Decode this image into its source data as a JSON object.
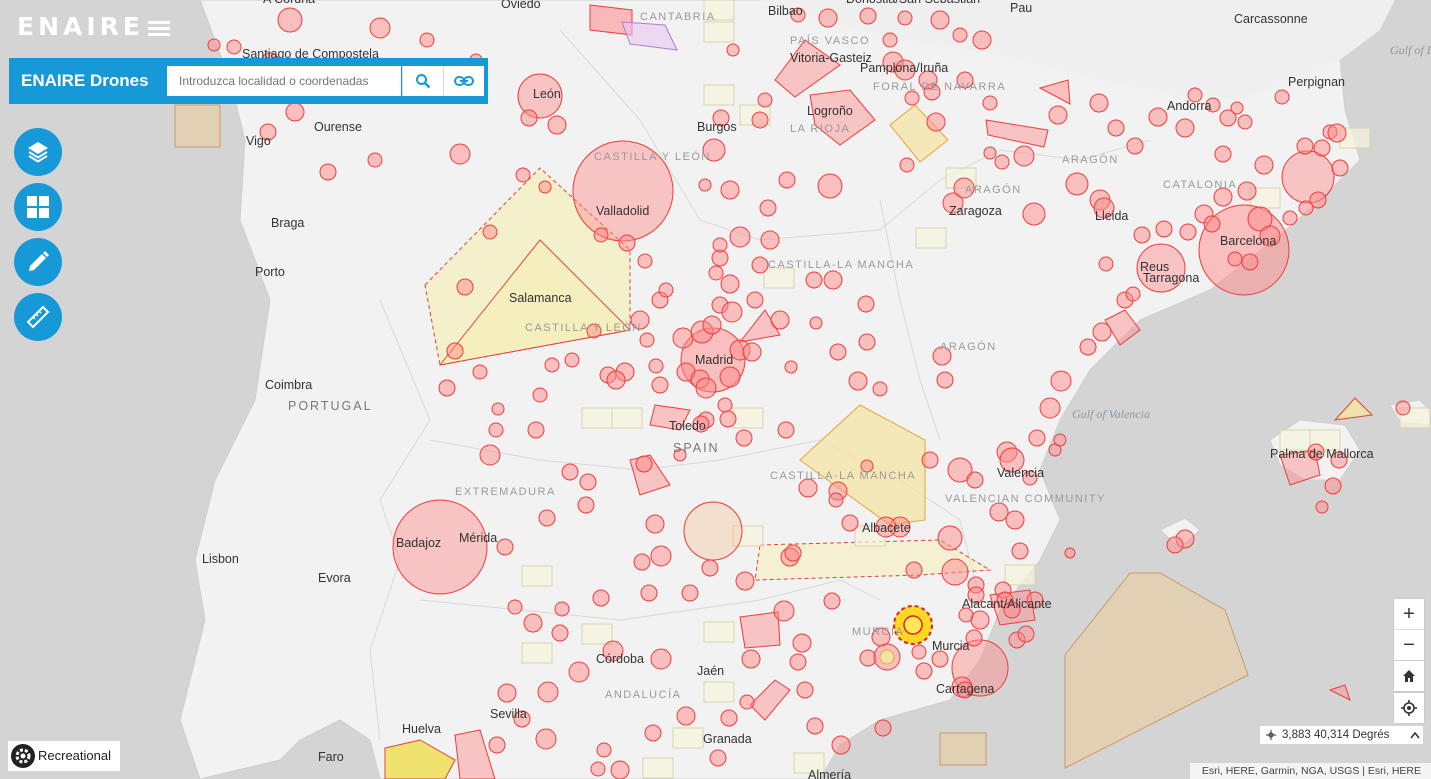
{
  "app": {
    "logo_text": "ENAIRE",
    "brand": "ENAIRE Drones"
  },
  "search": {
    "placeholder": "Introduzca localidad o coordenadas",
    "search_icon": "search-icon",
    "link_icon": "link-icon"
  },
  "tools": [
    {
      "name": "layers-button",
      "icon": "layers-icon"
    },
    {
      "name": "basemap-button",
      "icon": "grid-icon"
    },
    {
      "name": "draw-button",
      "icon": "pencil-icon"
    },
    {
      "name": "measure-button",
      "icon": "ruler-icon"
    }
  ],
  "map_controls": {
    "zoom_in": "+",
    "zoom_out": "−",
    "home_icon": "home-icon",
    "locate_icon": "locate-icon"
  },
  "coordinates": {
    "value": "3,883 40,314 Degrés",
    "crosshair_icon": "crosshair-icon",
    "chevron_icon": "chevron-up-icon"
  },
  "attribution": "Esri, HERE, Garmin, NGA, USGS | Esri, HERE",
  "mode": {
    "label": "Recreational",
    "icon": "gear-icon"
  },
  "colors": {
    "accent": "#1699d6",
    "zone_red_fill": "#ff8a8a",
    "zone_red_stroke": "#f03c3c",
    "zone_yellow_fill": "#f5eeb0",
    "zone_tan_fill": "#e8cfa8",
    "land": "#f2f2f2",
    "sea": "#d2d2d2"
  },
  "places": {
    "cities": [
      "A Coruña",
      "Oviedo",
      "Bilbao",
      "Donostia/San Sebastián",
      "Pau",
      "Carcassonne",
      "Santiago de Compostela",
      "León",
      "Vitoria-Gasteiz",
      "Pamplona/Iruña",
      "Perpignan",
      "Andorra",
      "Ourense",
      "Vigo",
      "Burgos",
      "Logroño",
      "Valladolid",
      "Zaragoza",
      "Lleida",
      "Barcelona",
      "Braga",
      "Porto",
      "Salamanca",
      "Reus",
      "Tarragona",
      "Madrid",
      "Coimbra",
      "Toledo",
      "Valencia",
      "Palma de Mallorca",
      "Badajoz",
      "Mérida",
      "Albacete",
      "Lisbon",
      "Evora",
      "Alacant/Alicante",
      "Murcia",
      "Cartagena",
      "Córdoba",
      "Jaén",
      "Sevilla",
      "Huelva",
      "Granada",
      "Faro",
      "Almería"
    ],
    "regions": [
      "CANTABRIA",
      "PAÍS VASCO",
      "FORAL DE NAVARRA",
      "LA RIOJA",
      "CASTILLA Y LEÓN",
      "ARAGÓN",
      "CATALONIA",
      "CASTILLA-LA MANCHA",
      "CASTILLA Y LEÓN",
      "EXTREMADURA",
      "CASTILLA-LA MANCHA",
      "VALENCIAN COMMUNITY",
      "ANDALUCÍA",
      "MURCIA"
    ],
    "countries": [
      "PORTUGAL",
      "SPAIN"
    ],
    "seas": [
      "Gulf of Lion",
      "Gulf of Valencia"
    ]
  }
}
